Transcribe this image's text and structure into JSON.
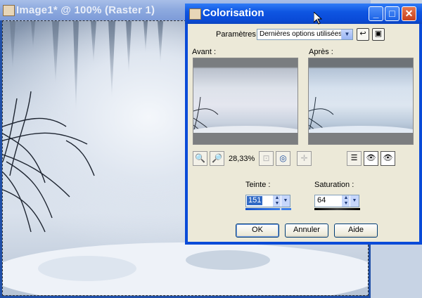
{
  "background_window": {
    "title": "Image1* @ 100% (Raster 1)",
    "icon": "image-icon"
  },
  "dialog": {
    "title": "Colorisation",
    "icon": "app-icon",
    "title_buttons": {
      "minimize": "_",
      "maximize": "□",
      "close": "✕"
    },
    "parametres_label": "Paramètres :",
    "parametres_value": "Dernières options utilisées",
    "avant_label": "Avant :",
    "apres_label": "Après :",
    "zoom_value": "28,33%",
    "teinte_label": "Teinte :",
    "teinte_value": "151",
    "saturation_label": "Saturation :",
    "saturation_value": "64",
    "ok_label": "OK",
    "cancel_label": "Annuler",
    "help_label": "Aide",
    "colors": {
      "title_bar": "#0a4bd8",
      "client": "#ece9d8",
      "selection": "#316ac5"
    }
  }
}
